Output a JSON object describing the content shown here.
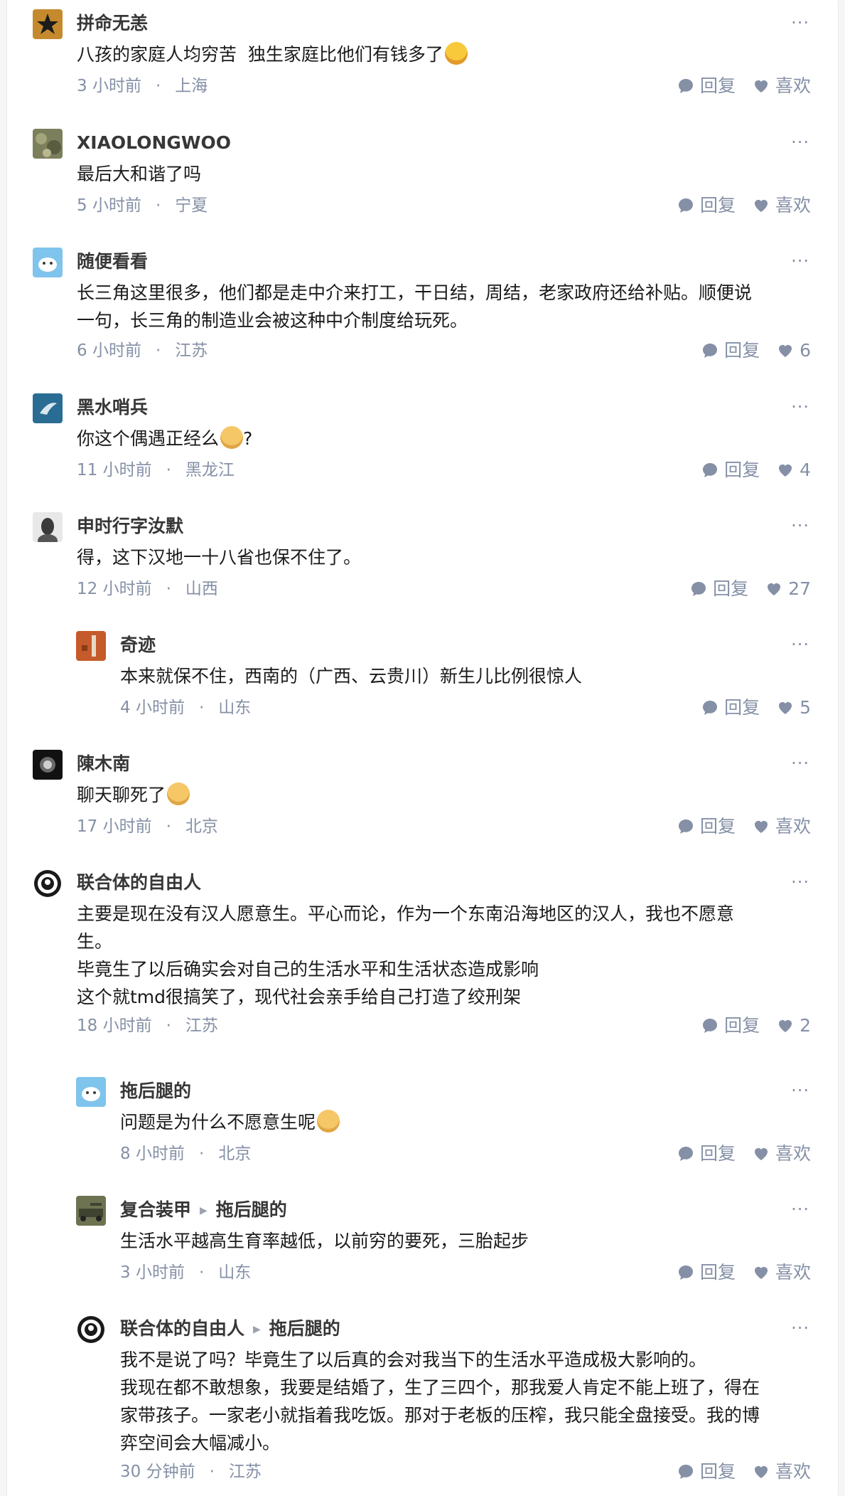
{
  "more_label": "···",
  "reply_label": "回复",
  "like_label": "喜欢",
  "comments": [
    {
      "author": "拼命无恙",
      "text": "八孩的家庭人均穷苦  独生家庭比他们有钱多了",
      "emoji": "rofl-emoji",
      "time": "3 小时前",
      "location": "上海",
      "likes": "喜欢"
    },
    {
      "author": "XIAOLONGWOO",
      "text": "最后大和谐了吗",
      "time": "5 小时前",
      "location": "宁夏",
      "likes": "喜欢"
    },
    {
      "author": "随便看看",
      "text": "长三角这里很多，他们都是走中介来打工，干日结，周结，老家政府还给补贴。顺便说\n一句，长三角的制造业会被这种中介制度给玩死。",
      "time": "6 小时前",
      "location": "江苏",
      "likes": "6"
    },
    {
      "author": "黑水哨兵",
      "text": "你这个偶遇正经么",
      "emoji": "bear-emoji",
      "text_after": "?",
      "time": "11 小时前",
      "location": "黑龙江",
      "likes": "4"
    },
    {
      "author": "申时行字汝默",
      "text": "得，这下汉地一十八省也保不住了。",
      "time": "12 小时前",
      "location": "山西",
      "likes": "27"
    },
    {
      "author": "奇迹",
      "text": "本来就保不住，西南的（广西、云贵川）新生儿比例很惊人",
      "time": "4 小时前",
      "location": "山东",
      "likes": "5"
    },
    {
      "author": "陳木南",
      "text": "聊天聊死了",
      "emoji": "bear-emoji",
      "time": "17 小时前",
      "location": "北京",
      "likes": "喜欢"
    },
    {
      "author": "联合体的自由人",
      "text": "主要是现在没有汉人愿意生。平心而论，作为一个东南沿海地区的汉人，我也不愿意\n生。\n毕竟生了以后确实会对自己的生活水平和生活状态造成影响\n这个就tmd很搞笑了，现代社会亲手给自己打造了绞刑架",
      "time": "18 小时前",
      "location": "江苏",
      "likes": "2"
    },
    {
      "author": "拖后腿的",
      "text": "问题是为什么不愿意生呢",
      "emoji": "bear-emoji",
      "time": "8 小时前",
      "location": "北京",
      "likes": "喜欢"
    },
    {
      "author": "复合装甲",
      "reply_to": "拖后腿的",
      "text": "生活水平越高生育率越低，以前穷的要死，三胎起步",
      "time": "3 小时前",
      "location": "山东",
      "likes": "喜欢"
    },
    {
      "author": "联合体的自由人",
      "reply_to": "拖后腿的",
      "text": "我不是说了吗？毕竟生了以后真的会对我当下的生活水平造成极大影响的。\n我现在都不敢想象，我要是结婚了，生了三四个，那我爱人肯定不能上班了，得在\n家带孩子。一家老小就指着我吃饭。那对于老板的压榨，我只能全盘接受。我的博\n弈空间会大幅减小。",
      "time": "30 分钟前",
      "location": "江苏",
      "likes": "喜欢"
    }
  ]
}
